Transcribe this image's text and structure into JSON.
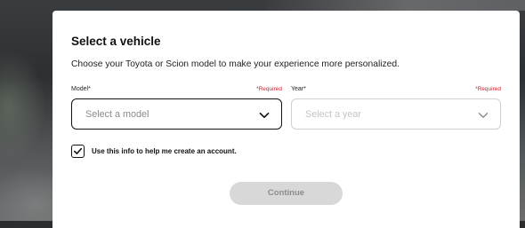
{
  "modal": {
    "title": "Select a vehicle",
    "subtitle": "Choose your Toyota or Scion model to make your experience more personalized."
  },
  "model_field": {
    "label": "Model*",
    "required_text": "*Required",
    "placeholder": "Select a model",
    "icon": "chevron-down-icon"
  },
  "year_field": {
    "label": "Year*",
    "required_text": "*Required",
    "placeholder": "Select a year",
    "icon": "chevron-down-icon"
  },
  "account_checkbox": {
    "checked": true,
    "label": "Use this info to help me create an account."
  },
  "continue_button": {
    "label": "Continue",
    "disabled": true
  },
  "colors": {
    "required": "#cc1f2e",
    "button_disabled_bg": "#d8d8d8",
    "button_disabled_text": "#8c8c8c",
    "border_active": "#111111",
    "border_inactive": "#d0d0d0"
  }
}
